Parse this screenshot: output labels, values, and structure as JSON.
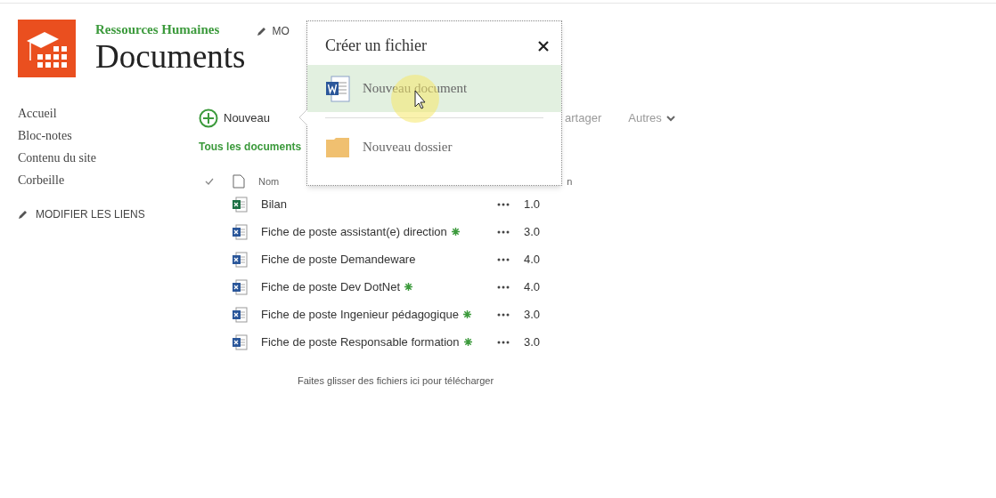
{
  "site": {
    "name": "Ressources Humaines",
    "title": "Documents",
    "edit_link": "MO"
  },
  "nav": {
    "items": [
      {
        "label": "Accueil"
      },
      {
        "label": "Bloc-notes"
      },
      {
        "label": "Contenu du site"
      },
      {
        "label": "Corbeille"
      }
    ],
    "edit_links": "MODIFIER LES LIENS"
  },
  "toolbar": {
    "new_button": "Nouveau",
    "share_button": "artager",
    "more_button": "Autres"
  },
  "view": {
    "label": "Tous les documents"
  },
  "table": {
    "columns": [
      "Nom",
      "n"
    ],
    "rows": [
      {
        "kind": "excel",
        "name": "Bilan",
        "new": false,
        "version": "1.0"
      },
      {
        "kind": "word",
        "name": "Fiche de poste assistant(e) direction",
        "new": true,
        "version": "3.0"
      },
      {
        "kind": "word",
        "name": "Fiche de poste Demandeware",
        "new": false,
        "version": "4.0"
      },
      {
        "kind": "word",
        "name": "Fiche de poste Dev DotNet",
        "new": true,
        "version": "4.0"
      },
      {
        "kind": "word",
        "name": "Fiche de poste Ingenieur pédagogique",
        "new": true,
        "version": "3.0"
      },
      {
        "kind": "word",
        "name": "Fiche de poste Responsable formation",
        "new": true,
        "version": "3.0"
      }
    ]
  },
  "drop_hint": "Faites glisser des fichiers ici pour télécharger",
  "popup": {
    "title": "Créer un fichier",
    "items": [
      {
        "kind": "word",
        "label": "Nouveau document",
        "selected": true
      },
      {
        "kind": "folder",
        "label": "Nouveau dossier",
        "selected": false
      }
    ]
  }
}
